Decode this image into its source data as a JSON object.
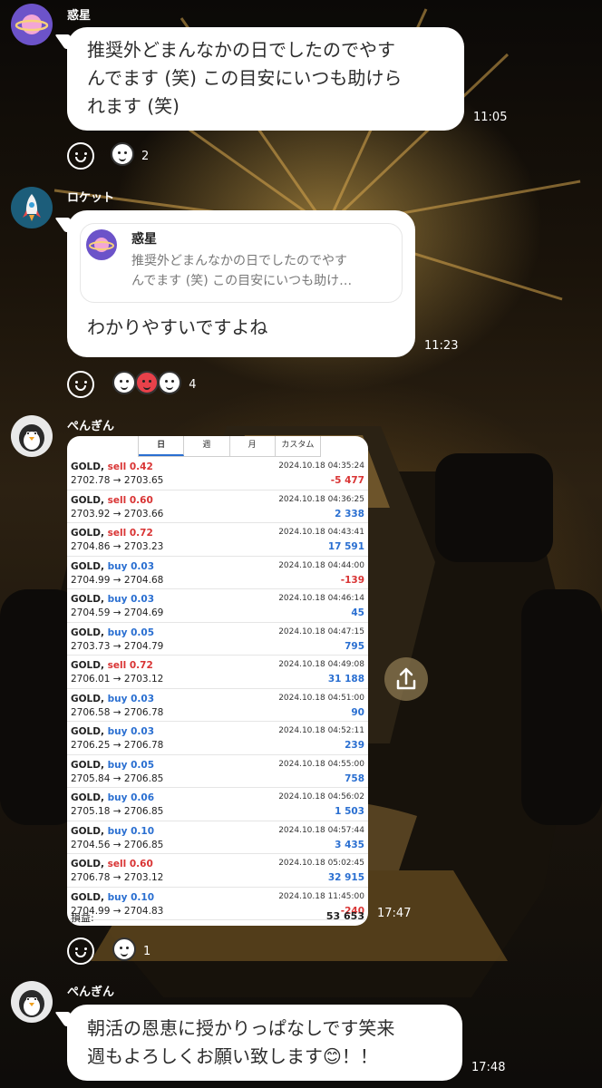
{
  "messages": [
    {
      "sender": "惑星",
      "text": "推奨外どまんなかの日でしたのでやすんでます (笑) この目安にいつも助けられます (笑)",
      "lines": [
        "推奨外どまんなかの日でしたのでやす",
        "んでます (笑) この目安にいつも助けら",
        "れます (笑)"
      ],
      "time": "11:05",
      "reaction_count": "2"
    },
    {
      "sender": "ロケット",
      "quote": {
        "sender": "惑星",
        "lines": [
          "推奨外どまんなかの日でしたのでやす",
          "んでます (笑) この目安にいつも助け…"
        ]
      },
      "text": "わかりやすいですよね",
      "time": "11:23",
      "reaction_count": "4"
    },
    {
      "sender": "ぺんぎん",
      "time": "17:47",
      "reaction_count": "1",
      "screenshot": {
        "tabs": [
          "日",
          "週",
          "月",
          "カスタム"
        ],
        "rows": [
          {
            "symbol": "GOLD,",
            "side": "sell",
            "lots": "0.42",
            "prices": "2702.78 → 2703.65",
            "datetime": "2024.10.18 04:35:24",
            "pl": "-5 477"
          },
          {
            "symbol": "GOLD,",
            "side": "sell",
            "lots": "0.60",
            "prices": "2703.92 → 2703.66",
            "datetime": "2024.10.18 04:36:25",
            "pl": "2 338"
          },
          {
            "symbol": "GOLD,",
            "side": "sell",
            "lots": "0.72",
            "prices": "2704.86 → 2703.23",
            "datetime": "2024.10.18 04:43:41",
            "pl": "17 591"
          },
          {
            "symbol": "GOLD,",
            "side": "buy",
            "lots": "0.03",
            "prices": "2704.99 → 2704.68",
            "datetime": "2024.10.18 04:44:00",
            "pl": "-139"
          },
          {
            "symbol": "GOLD,",
            "side": "buy",
            "lots": "0.03",
            "prices": "2704.59 → 2704.69",
            "datetime": "2024.10.18 04:46:14",
            "pl": "45"
          },
          {
            "symbol": "GOLD,",
            "side": "buy",
            "lots": "0.05",
            "prices": "2703.73 → 2704.79",
            "datetime": "2024.10.18 04:47:15",
            "pl": "795"
          },
          {
            "symbol": "GOLD,",
            "side": "sell",
            "lots": "0.72",
            "prices": "2706.01 → 2703.12",
            "datetime": "2024.10.18 04:49:08",
            "pl": "31 188"
          },
          {
            "symbol": "GOLD,",
            "side": "buy",
            "lots": "0.03",
            "prices": "2706.58 → 2706.78",
            "datetime": "2024.10.18 04:51:00",
            "pl": "90"
          },
          {
            "symbol": "GOLD,",
            "side": "buy",
            "lots": "0.03",
            "prices": "2706.25 → 2706.78",
            "datetime": "2024.10.18 04:52:11",
            "pl": "239"
          },
          {
            "symbol": "GOLD,",
            "side": "buy",
            "lots": "0.05",
            "prices": "2705.84 → 2706.85",
            "datetime": "2024.10.18 04:55:00",
            "pl": "758"
          },
          {
            "symbol": "GOLD,",
            "side": "buy",
            "lots": "0.06",
            "prices": "2705.18 → 2706.85",
            "datetime": "2024.10.18 04:56:02",
            "pl": "1 503"
          },
          {
            "symbol": "GOLD,",
            "side": "buy",
            "lots": "0.10",
            "prices": "2704.56 → 2706.85",
            "datetime": "2024.10.18 04:57:44",
            "pl": "3 435"
          },
          {
            "symbol": "GOLD,",
            "side": "sell",
            "lots": "0.60",
            "prices": "2706.78 → 2703.12",
            "datetime": "2024.10.18 05:02:45",
            "pl": "32 915"
          },
          {
            "symbol": "GOLD,",
            "side": "buy",
            "lots": "0.10",
            "prices": "2704.99 → 2704.83",
            "datetime": "2024.10.18 11:45:00",
            "pl": "-240"
          }
        ],
        "total_label": "損益:",
        "total_value": "53 653"
      }
    },
    {
      "sender": "ぺんぎん",
      "lines": [
        "朝活の恩恵に授かりっぱなしです笑来",
        "週もよろしくお願い致します😊！！"
      ],
      "time": "17:48"
    }
  ],
  "colors": {
    "sell": "#d93434",
    "buy": "#2a6fd1",
    "bubble": "#ffffff"
  },
  "icons": [
    "planet-icon",
    "rocket-icon",
    "penguin-icon",
    "smiley-reaction-icon",
    "share-icon"
  ]
}
